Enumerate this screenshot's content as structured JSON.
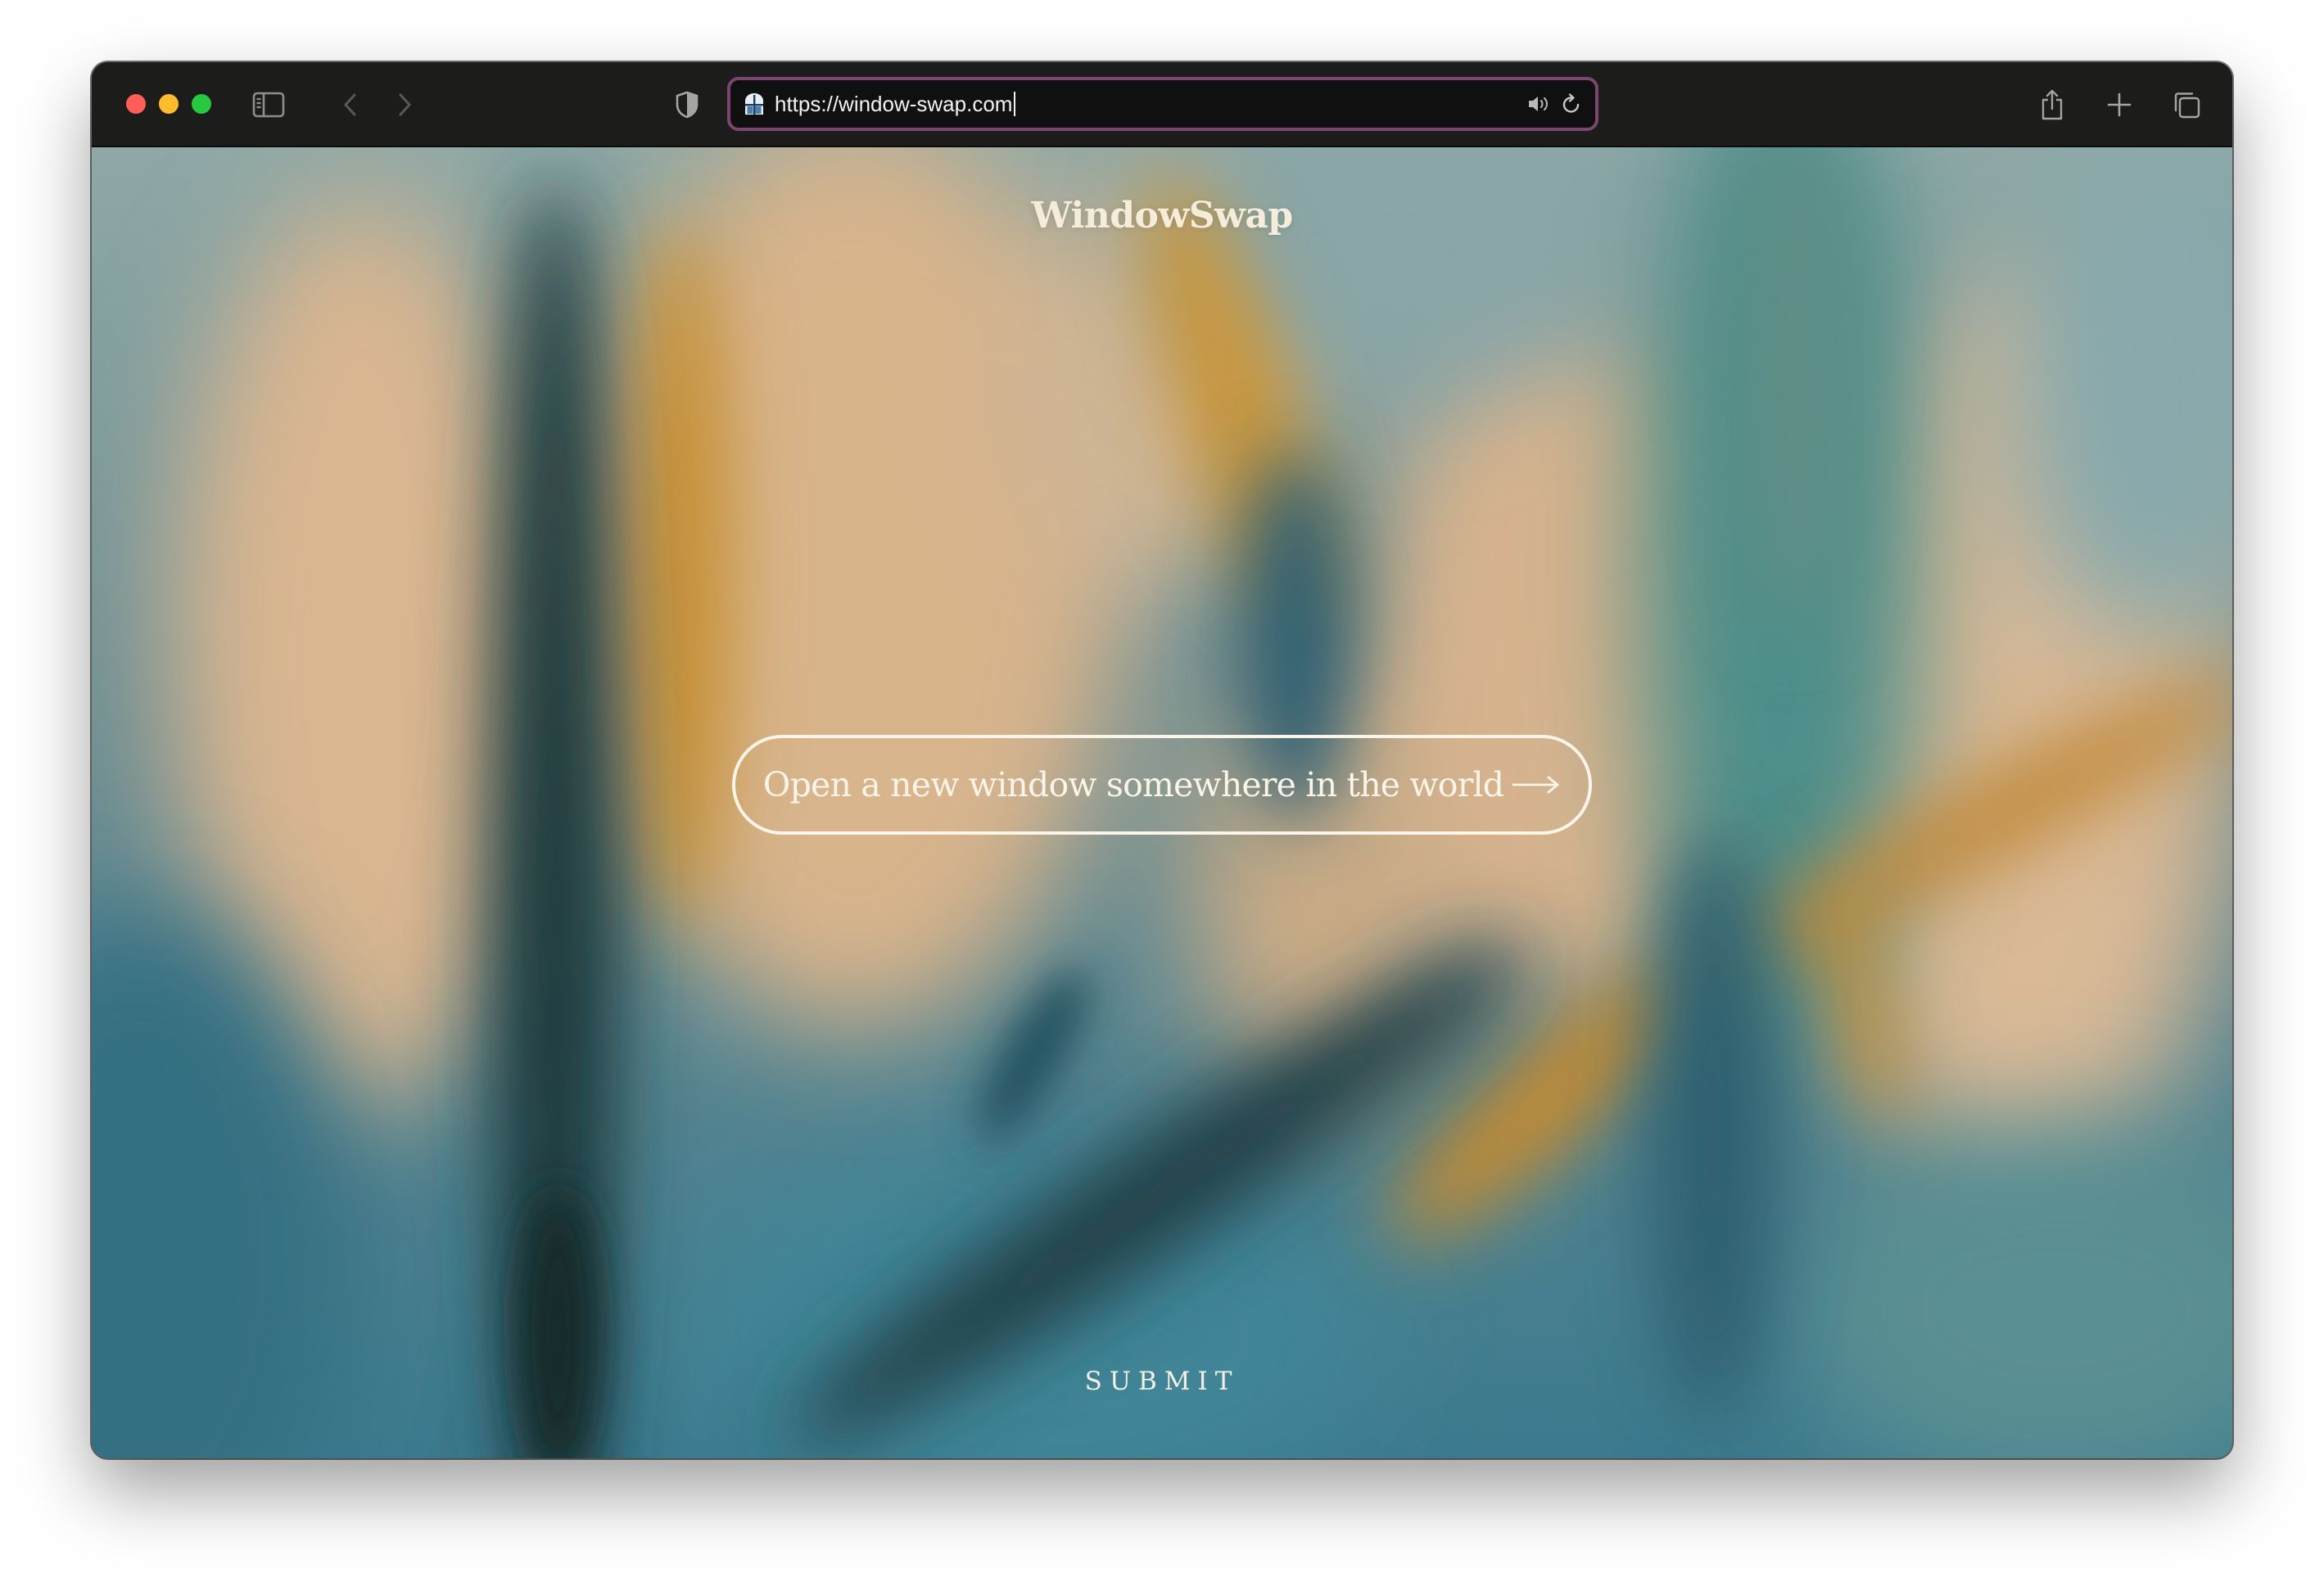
{
  "browser": {
    "url": "https://window-swap.com",
    "traffic_lights": {
      "close": "#ff5f57",
      "minimize": "#febc2e",
      "zoom": "#28c840"
    },
    "address_bar_border": "#7b4672",
    "icons": {
      "sidebar": "sidebar-icon",
      "back": "chevron-left-icon",
      "forward": "chevron-right-icon",
      "privacy": "shield-icon",
      "favicon": "window-favicon-icon",
      "audio": "speaker-icon",
      "reload": "reload-icon",
      "share": "share-icon",
      "new_tab": "plus-icon",
      "tab_overview": "tab-overview-icon"
    }
  },
  "page": {
    "brand": "WindowSwap",
    "cta_label": "Open a new window somewhere in the world",
    "cta_arrow_icon": "long-arrow-right-icon",
    "submit_label": "SUBMIT",
    "text_color": "#fbf4e8",
    "background_palette": [
      "#d9b48c",
      "#c8922f",
      "#3d7a8c",
      "#1e3a3d",
      "#5b8a8e"
    ]
  }
}
